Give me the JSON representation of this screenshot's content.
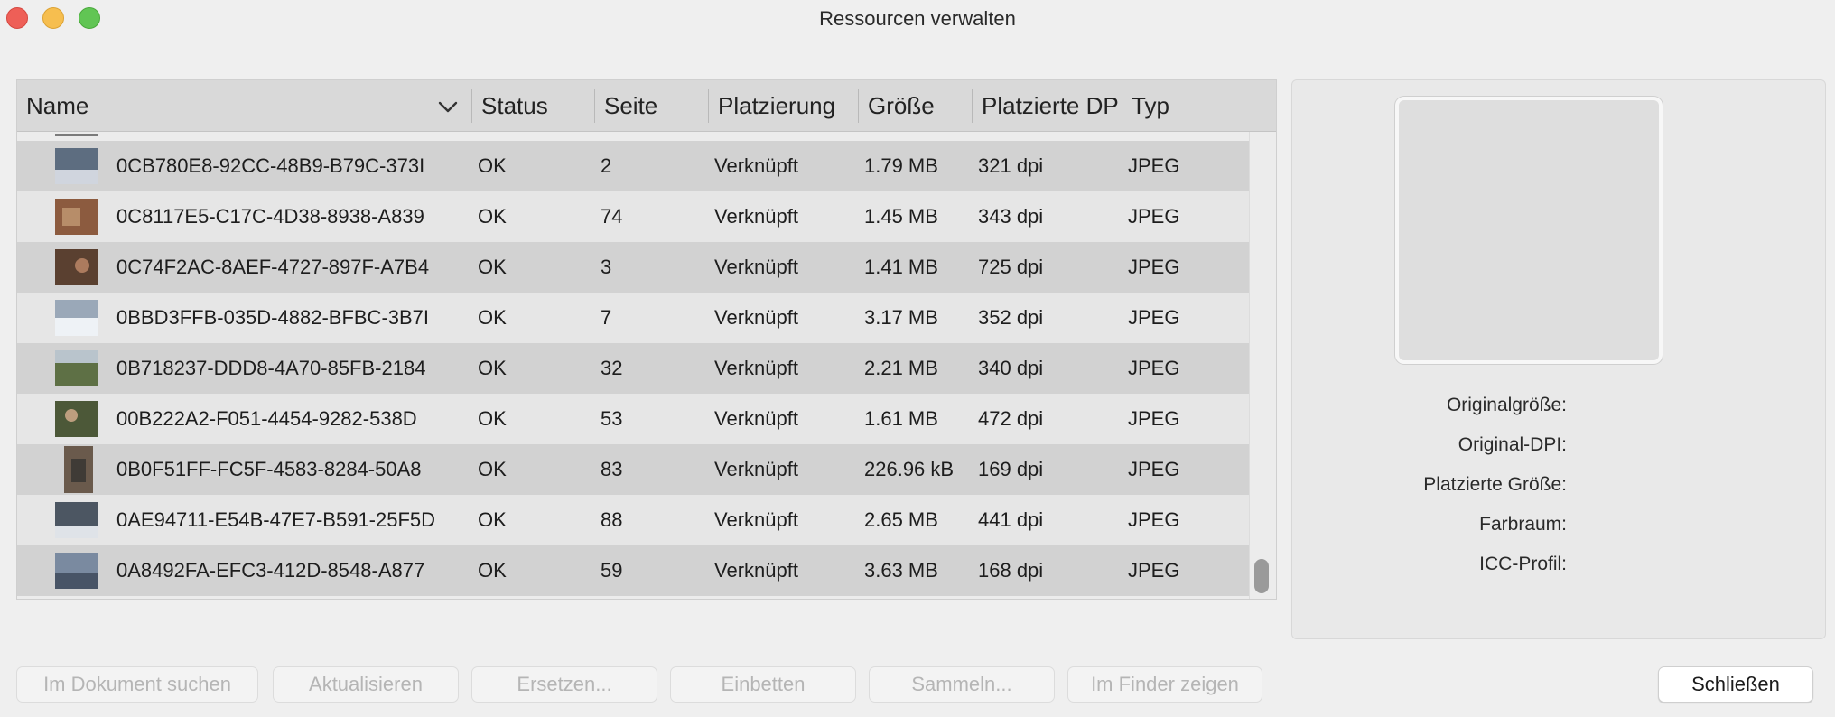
{
  "window": {
    "title": "Ressourcen verwalten",
    "controls": [
      "close",
      "minimize",
      "maximize"
    ]
  },
  "table": {
    "columns": [
      "Name",
      "Status",
      "Seite",
      "Platzierung",
      "Größe",
      "Platzierte DP",
      "Typ"
    ],
    "sort_icon": "chevron-down-icon",
    "rows": [
      {
        "name": "0CB780E8-92CC-48B9-B79C-373I",
        "status": "OK",
        "page": "2",
        "placement": "Verknüpft",
        "size": "1.79 MB",
        "dpi": "321 dpi",
        "type": "JPEG",
        "thumb_color": "#5d6d80"
      },
      {
        "name": "0C8117E5-C17C-4D38-8938-A839",
        "status": "OK",
        "page": "74",
        "placement": "Verknüpft",
        "size": "1.45 MB",
        "dpi": "343 dpi",
        "type": "JPEG",
        "thumb_color": "#8c5b3f"
      },
      {
        "name": "0C74F2AC-8AEF-4727-897F-A7B4",
        "status": "OK",
        "page": "3",
        "placement": "Verknüpft",
        "size": "1.41 MB",
        "dpi": "725 dpi",
        "type": "JPEG",
        "thumb_color": "#5a4030"
      },
      {
        "name": "0BBD3FFB-035D-4882-BFBC-3B7I",
        "status": "OK",
        "page": "7",
        "placement": "Verknüpft",
        "size": "3.17 MB",
        "dpi": "352 dpi",
        "type": "JPEG",
        "thumb_color": "#9aa8b8"
      },
      {
        "name": "0B718237-DDD8-4A70-85FB-2184",
        "status": "OK",
        "page": "32",
        "placement": "Verknüpft",
        "size": "2.21 MB",
        "dpi": "340 dpi",
        "type": "JPEG",
        "thumb_color": "#5e7045"
      },
      {
        "name": "00B222A2-F051-4454-9282-538D",
        "status": "OK",
        "page": "53",
        "placement": "Verknüpft",
        "size": "1.61 MB",
        "dpi": "472 dpi",
        "type": "JPEG",
        "thumb_color": "#4c5838"
      },
      {
        "name": "0B0F51FF-FC5F-4583-8284-50A8",
        "status": "OK",
        "page": "83",
        "placement": "Verknüpft",
        "size": "226.96 kB",
        "dpi": "169 dpi",
        "type": "JPEG",
        "thumb_color": "#6a5a4c"
      },
      {
        "name": "0AE94711-E54B-47E7-B591-25F5D",
        "status": "OK",
        "page": "88",
        "placement": "Verknüpft",
        "size": "2.65 MB",
        "dpi": "441 dpi",
        "type": "JPEG",
        "thumb_color": "#4c5662"
      },
      {
        "name": "0A8492FA-EFC3-412D-8548-A877",
        "status": "OK",
        "page": "59",
        "placement": "Verknüpft",
        "size": "3.63 MB",
        "dpi": "168 dpi",
        "type": "JPEG",
        "thumb_color": "#7a8aa0"
      }
    ]
  },
  "info": {
    "labels": [
      "Originalgröße:",
      "Original-DPI:",
      "Platzierte Größe:",
      "Farbraum:",
      "ICC-Profil:"
    ]
  },
  "buttons": {
    "find_in_document": "Im Dokument suchen",
    "update": "Aktualisieren",
    "replace": "Ersetzen...",
    "embed": "Einbetten",
    "collect": "Sammeln...",
    "show_in_finder": "Im Finder zeigen",
    "close": "Schließen"
  }
}
